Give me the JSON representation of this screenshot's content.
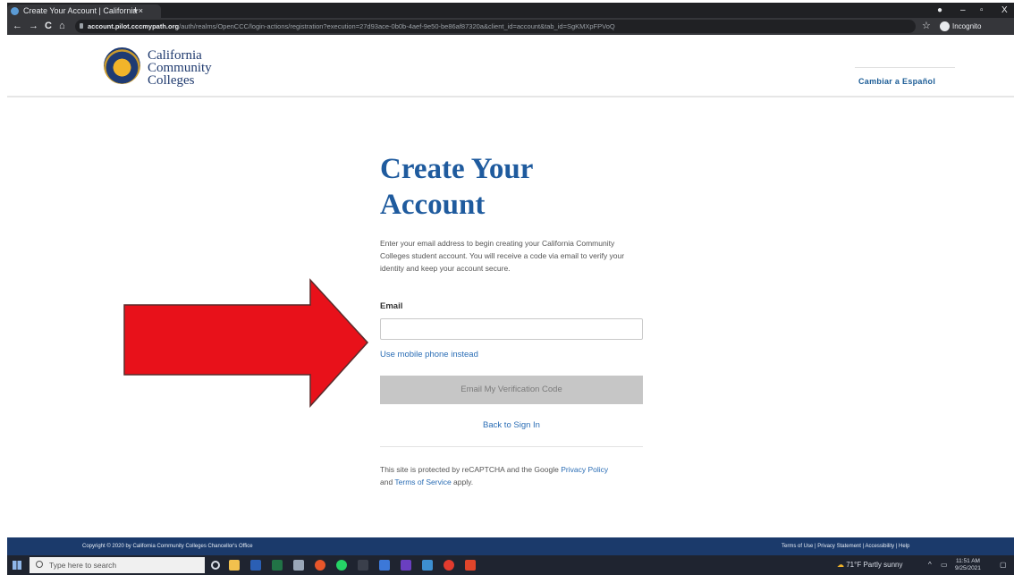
{
  "browser": {
    "tab_title": "Create Your Account | California",
    "tab_close": "×",
    "new_tab": "+",
    "url_host": "account.pilot.cccmypath.org",
    "url_path": "/auth/realms/OpenCCC/login-actions/registration?execution=27d93ace-0b0b-4aef-9e50-be86af87320a&client_id=account&tab_id=SgKMXpFPVoQ",
    "incognito_label": "Incognito",
    "nav_back": "←",
    "nav_forward": "→",
    "nav_reload": "C",
    "nav_home": "⌂",
    "star": "☆",
    "win_minimize": "–",
    "win_restore": "▫",
    "win_close": "X"
  },
  "header": {
    "logo_line1": "California",
    "logo_line2": "Community",
    "logo_line3": "Colleges",
    "language_link": "Cambiar a Español"
  },
  "form": {
    "title_line1": "Create Your",
    "title_line2": "Account",
    "intro": "Enter your email address to begin creating your California Community Colleges student account. You will receive a code via email to verify your identity and keep your account secure.",
    "email_label": "Email",
    "email_value": "",
    "alt_link": "Use mobile phone instead",
    "submit_label": "Email My Verification Code",
    "back_link": "Back to Sign In",
    "recaptcha_prefix": "This site is protected by reCAPTCHA and the Google ",
    "privacy_link": "Privacy Policy",
    "recaptcha_and": " and ",
    "terms_link": "Terms of Service",
    "recaptcha_suffix": " apply."
  },
  "footer": {
    "copyright": "Copyright © 2020 by California Community Colleges Chancellor's Office",
    "links": "Terms of Use | Privacy Statement | Accessibility | Help"
  },
  "taskbar": {
    "search_placeholder": "Type here to search",
    "weather": "71°F  Partly sunny",
    "tray_chevron": "^",
    "time": "11:51 AM",
    "date": "9/25/2021"
  },
  "colors": {
    "heading": "#1f5b9e",
    "link": "#2a6db5",
    "footer_bg": "#1b3a6b",
    "arrow": "#e8111a"
  }
}
